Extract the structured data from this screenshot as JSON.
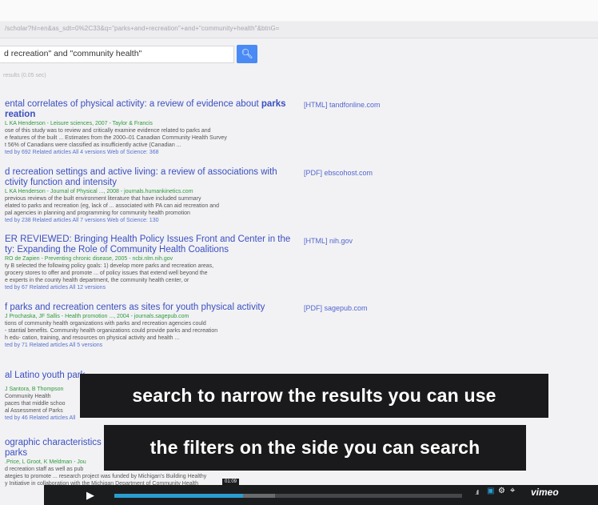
{
  "url": "/scholar?hl=en&as_sdt=0%2C33&q=\"parks+and+recreation\"+and+\"community+health\"&btnG=",
  "search": {
    "query": "d recreation\" and \"community health\""
  },
  "results_count": "results (0.05 sec)",
  "results": [
    {
      "title_line1": "ental correlates of physical activity: a review of evidence about ",
      "title_bold": "parks",
      "title_line2": "reation",
      "authors": "L KA Henderson - Leisure sciences, 2007 - Taylor & Francis",
      "snippet1": "ose of this study was to review and critically examine evidence related to parks and",
      "snippet2": "e features of the built ... Estimates from the 2000–01 Canadian Community Health Survey",
      "snippet3": "t 56% of Canadians were classified as insufficiently active (Canadian ...",
      "links": "ted by 692   Related articles   All 4 versions   Web of Science: 368",
      "source": "[HTML] tandfonline.com"
    },
    {
      "title_line1": "d recreation settings and active living: a review of associations with",
      "title_line2": "ctivity function and intensity",
      "authors": "L KA Henderson - Journal of Physical ..., 2008 - journals.humankinetics.com",
      "snippet1": "previous reviews of the built environment literature that have included summary",
      "snippet2": "elated to parks and recreation (eg, lack of ... associated with PA can aid recreation and",
      "snippet3": "pal agencies in planning and programming for community health promotion",
      "links": "ted by 238   Related articles   All 7 versions   Web of Science: 130",
      "source": "[PDF] ebscohost.com"
    },
    {
      "title_line1": "ER REVIEWED: Bringing Health Policy Issues Front and Center in the",
      "title_line2": "ty: Expanding the Role of Community Health Coalitions",
      "authors": "RO de Zapien - Preventing chronic disease, 2005 - ncbi.nlm.nih.gov",
      "snippet1": "ty B selected the following policy goals: 1) develop more parks and recreation areas,",
      "snippet2": "grocery stores to offer and promote ... of policy issues that extend well beyond the",
      "snippet3": "e experts in the county health department, the community health center, or",
      "links": "ted by 67   Related articles   All 12 versions",
      "source": "[HTML] nih.gov"
    },
    {
      "title_line1": "f parks and recreation centers as sites for youth physical activity",
      "authors": "J Prochaska, JF Sallis - Health promotion ..., 2004 - journals.sagepub.com",
      "snippet1": "tions of community health organizations with parks and recreation agencies could",
      "snippet2": "- stantial benefits. Community health organizations could provide parks and recreation",
      "snippet3": "h edu- cation, training, and resources on physical activity and health ...",
      "links": "ted by 71   Related articles   All 5 versions",
      "source": "[PDF] sagepub.com"
    },
    {
      "title_line1": "al Latino youth park",
      "authors": "J Santora, B Thompson",
      "snippet1": "Community Health",
      "snippet2": "paces that middle schoo",
      "snippet3": "al Assessment of Parks",
      "links": "ted by 46   Related articles   All"
    },
    {
      "title_line1": "ographic characteristics",
      "title_line2": "parks",
      "authors": ".Price, L Groot, K Meldman - Jou",
      "snippet1": "d recreation staff as well as pub",
      "snippet2": "ategies to promote ... research project was funded by Michigan's Building Healthy",
      "snippet3": "y Initiative in collaboration with the Michigan Department of Community Health"
    }
  ],
  "captions": {
    "line1": "search to narrow the results you can use",
    "line2": "the filters on the side you can search"
  },
  "player": {
    "time": "01:09",
    "brand": "vimeo",
    "progress_fraction": 0.37
  }
}
